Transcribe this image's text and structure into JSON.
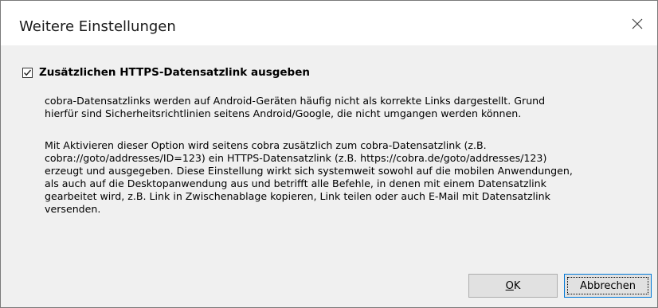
{
  "window": {
    "title": "Weitere Einstellungen"
  },
  "option": {
    "checked": true,
    "label": "Zusätzlichen HTTPS-Datensatzlink ausgeben"
  },
  "description": {
    "paragraph1": "cobra-Datensatzlinks werden auf Android-Geräten häufig nicht als korrekte Links dargestellt. Grund\nhierfür sind Sicherheitsrichtlinien seitens Android/Google, die nicht umgangen werden können.",
    "paragraph2": "Mit Aktivieren dieser Option wird seitens cobra zusätzlich zum cobra-Datensatzlink (z.B.\ncobra://goto/addresses/ID=123) ein HTTPS-Datensatzlink (z.B. https://cobra.de/goto/addresses/123)\nerzeugt und ausgegeben. Diese Einstellung wirkt sich systemweit sowohl auf die mobilen Anwendungen,\nals auch auf die Desktopanwendung aus und betrifft alle Befehle, in denen mit einem Datensatzlink\ngearbeitet wird, z.B. Link in Zwischenablage kopieren, Link teilen oder auch E-Mail mit Datensatzlink\nversenden."
  },
  "buttons": {
    "ok_label": "OK",
    "cancel_label": "Abbrechen"
  },
  "icons": {
    "close": "close-icon",
    "check": "checkmark-icon"
  }
}
